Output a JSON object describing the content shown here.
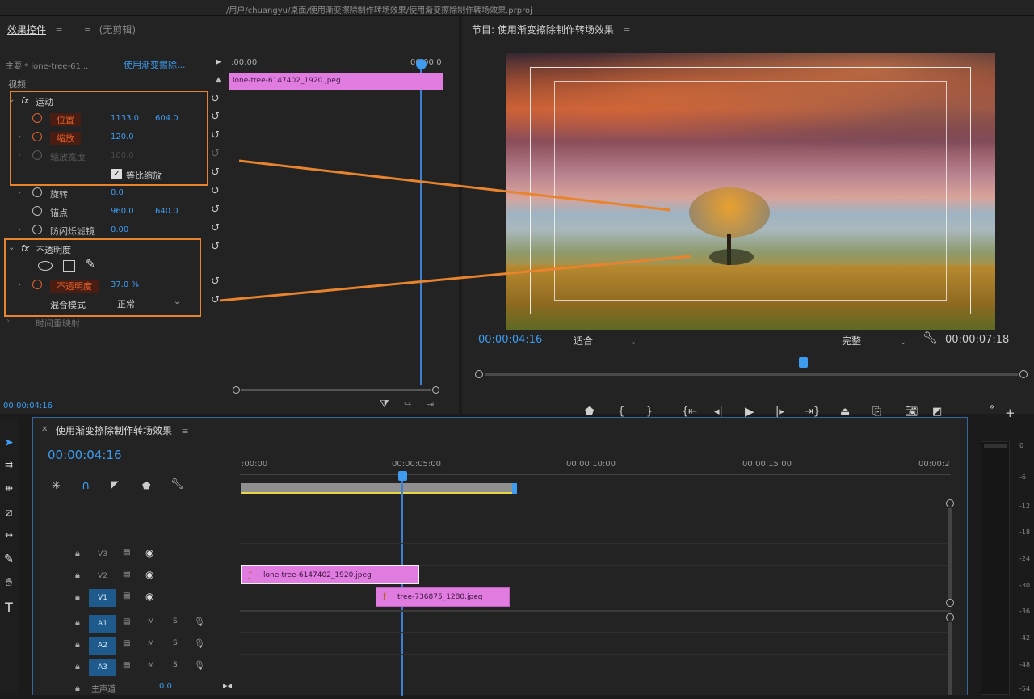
{
  "window": {
    "title_path": "/用户/chuangyu/桌面/使用渐变擦除制作转场效果/使用渐变擦除制作转场效果.prproj"
  },
  "effect_controls": {
    "tab_label": "效果控件",
    "tab2_label": "(无剪辑)",
    "source_label": "主要 * lone-tree-61...",
    "sequence_link": "使用渐变擦除...",
    "timecode_start": ":00:00",
    "timecode_end": "00:00:0",
    "clip_name": "lone-tree-6147402_1920.jpeg",
    "video_header": "视频",
    "motion": {
      "label": "运动",
      "position_label": "位置",
      "position_x": "1133.0",
      "position_y": "604.0",
      "scale_label": "缩放",
      "scale_value": "120.0",
      "scale_width_label": "缩放宽度",
      "scale_width_value": "100.0",
      "uniform_label": "等比缩放",
      "rotation_label": "旋转",
      "rotation_value": "0.0",
      "anchor_label": "锚点",
      "anchor_x": "960.0",
      "anchor_y": "640.0",
      "antiflicker_label": "防闪烁滤镜",
      "antiflicker_value": "0.00"
    },
    "opacity": {
      "label": "不透明度",
      "opacity_label": "不透明度",
      "opacity_value": "37.0 %",
      "blend_label": "混合模式",
      "blend_value": "正常"
    },
    "time_remap_label": "时间重映射",
    "footer_timecode": "00:00:04:16"
  },
  "program_monitor": {
    "title": "节目: 使用渐变擦除制作转场效果",
    "current_time": "00:00:04:16",
    "fit_label": "适合",
    "quality_label": "完整",
    "duration": "00:00:07:18"
  },
  "timeline": {
    "sequence_name": "使用渐变擦除制作转场效果",
    "current_time": "00:00:04:16",
    "ruler_labels": [
      ":00:00",
      "00:00:05:00",
      "00:00:10:00",
      "00:00:15:00",
      "00:00:2"
    ],
    "tracks": [
      {
        "name": "V3",
        "selected": false
      },
      {
        "name": "V2",
        "selected": false
      },
      {
        "name": "V1",
        "selected": true
      },
      {
        "name": "A1",
        "selected": true
      },
      {
        "name": "A2",
        "selected": true
      },
      {
        "name": "A3",
        "selected": true
      }
    ],
    "audio_m": "M",
    "audio_s": "S",
    "master_label": "主声道",
    "master_value": "0.0",
    "clips": [
      {
        "name": "lone-tree-6147402_1920.jpeg",
        "track": "V2"
      },
      {
        "name": "tree-736875_1280.jpeg",
        "track": "V1"
      }
    ]
  },
  "meter_labels": [
    "0",
    "-6",
    "-12",
    "-18",
    "-24",
    "-30",
    "-36",
    "-42",
    "-48",
    "-54"
  ],
  "colors": {
    "accent_blue": "#3d9cf0",
    "clip_pink": "#e07be0",
    "highlight_orange": "#e8832e",
    "keyframe_red": "#e2602e"
  }
}
